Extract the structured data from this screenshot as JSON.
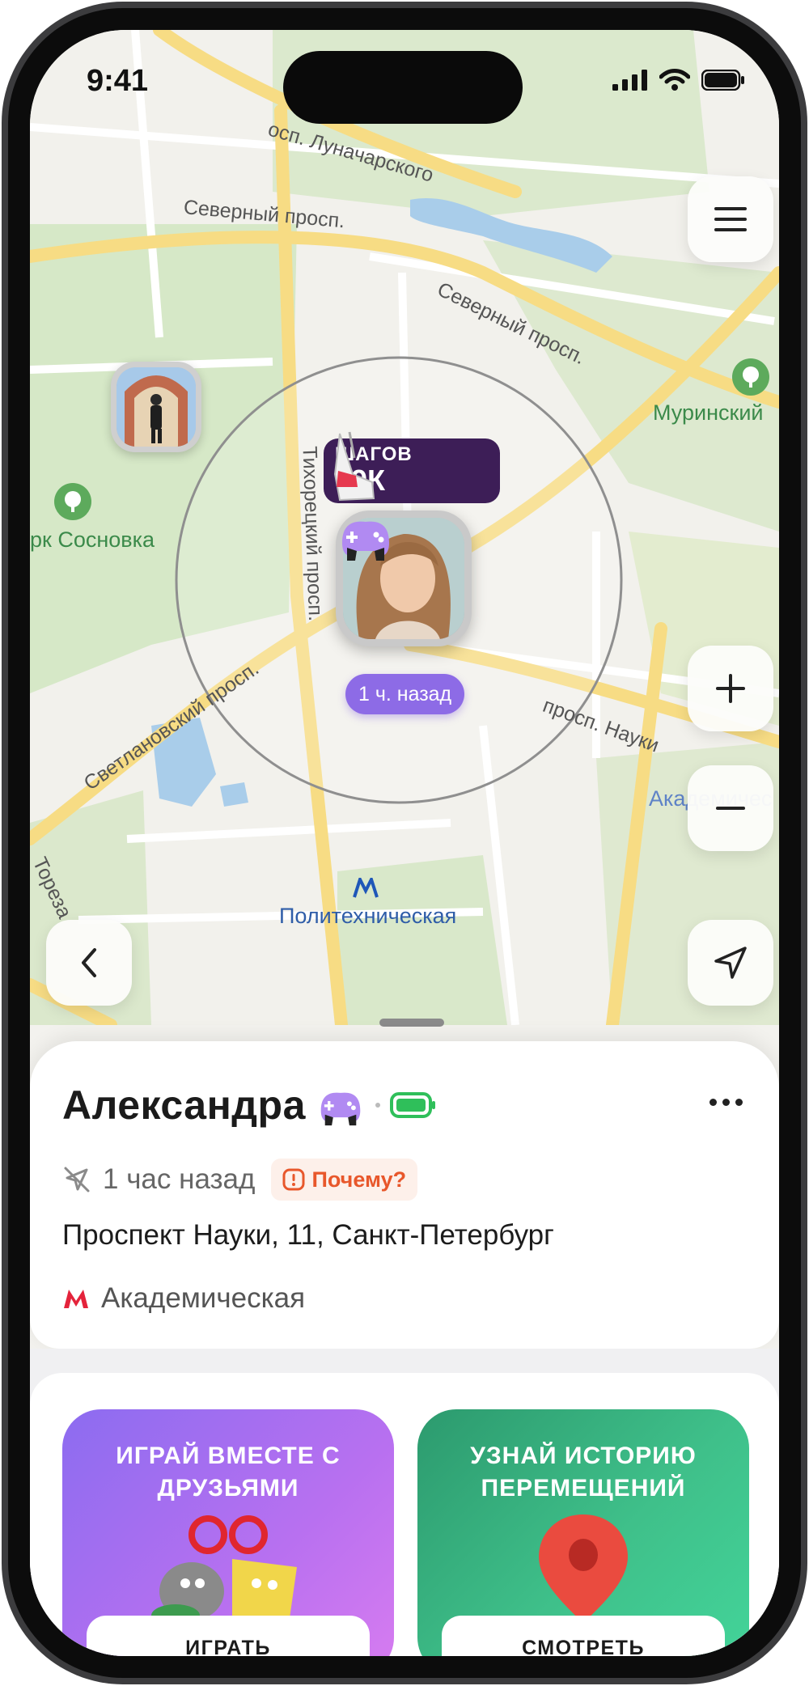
{
  "status_bar": {
    "time": "9:41"
  },
  "map": {
    "streets": [
      {
        "id": "lunacharskogo",
        "label": "осп. Луначарского"
      },
      {
        "id": "severny-1",
        "label": "Северный просп."
      },
      {
        "id": "severny-2",
        "label": "Северный просп."
      },
      {
        "id": "tikhoretsky",
        "label": "Тихорецкий просп."
      },
      {
        "id": "svetlanovsky",
        "label": "Светлановский просп."
      },
      {
        "id": "nauki",
        "label": "просп. Науки"
      },
      {
        "id": "toreza",
        "label": "Тореза"
      }
    ],
    "parks": [
      {
        "id": "sosnovka",
        "label": "рк Сосновка"
      },
      {
        "id": "murinsky",
        "label": "Муринский"
      }
    ],
    "metro_stations": [
      {
        "id": "politekhnicheskaya",
        "label": "Политехническая"
      },
      {
        "id": "akademicheskaya",
        "label": "Академичес"
      }
    ],
    "steps_badge": {
      "line1": "ШАГОВ",
      "line2": "99К"
    },
    "last_seen_pill": "1 ч. назад"
  },
  "person": {
    "name": "Александра",
    "last_seen": "1 час назад",
    "why_label": "Почему?",
    "address": "Проспект Науки, 11, Санкт-Петербург",
    "metro": "Академическая"
  },
  "promos": [
    {
      "id": "play",
      "title": "ИГРАЙ ВМЕСТЕ С ДРУЗЬЯМИ",
      "button": "ИГРАТЬ"
    },
    {
      "id": "history",
      "title": "УЗНАЙ ИСТОРИЮ ПЕРЕМЕЩЕНИЙ",
      "button": "СМОТРЕТЬ"
    }
  ],
  "colors": {
    "accent_purple": "#8d6be6",
    "battery_green": "#2fbf5a",
    "metro_red": "#e4233b",
    "warning_orange": "#e8572b"
  }
}
